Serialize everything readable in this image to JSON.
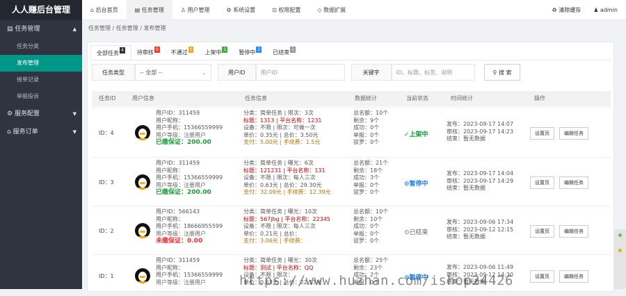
{
  "brand": "人人赚后台管理",
  "sidebar": {
    "groups": [
      {
        "label": "任务管理",
        "items": [
          "任务分类",
          "发布管理",
          "接单记录",
          "举报投诉"
        ]
      },
      {
        "label": "服务配置"
      },
      {
        "label": "服务订单"
      }
    ]
  },
  "topnav": [
    "后台首页",
    "任务管理",
    "用户管理",
    "系统设置",
    "权限配置",
    "数据扩展"
  ],
  "topright": {
    "clear": "清除缓存",
    "user": "admin"
  },
  "breadcrumb": "任务管理  /  任务管理  /  发布管理",
  "tabs": [
    {
      "label": "全部任务",
      "count": "4",
      "color": "#333"
    },
    {
      "label": "待审核",
      "count": "0",
      "color": "#ff3b30"
    },
    {
      "label": "不通过",
      "count": "0",
      "color": "#f5a623"
    },
    {
      "label": "上架中",
      "count": "1",
      "color": "#3fb33f"
    },
    {
      "label": "暂停中",
      "count": "2",
      "color": "#1e90ff"
    },
    {
      "label": "已结束",
      "count": "1",
      "color": "#999"
    }
  ],
  "filters": {
    "type_label": "任务类型",
    "type_value": "-- 全部 --",
    "uid_label": "用户ID",
    "uid_placeholder": "用户ID",
    "kw_label": "关键字",
    "kw_placeholder": "ID、标题、标签、说明",
    "search": "搜 索"
  },
  "columns": [
    "任务ID",
    "用户信息",
    "任务信息",
    "数据统计",
    "当前状态",
    "时间统计",
    "操作"
  ],
  "rows": [
    {
      "id": "ID：4",
      "user": [
        "用户ID：311459",
        "用户昵称：",
        "用户手机：15366559999",
        "用户等级：注册用户",
        "已缴保证：200.00"
      ],
      "task": [
        "分类：简单任务 | 限次：3次",
        "标题：1313 | 平台名称：1231",
        "设备：不限 | 限次：可做一次",
        "单价：0.35元 | 总价：3.50元",
        "支付：5.00元 | 手续费：1.5元"
      ],
      "stats": [
        "总名额：10个",
        "剩余：9个",
        "成功：0个",
        "举报：0个",
        "驳罗：0个"
      ],
      "status": "✓上架中",
      "time": [
        "发布：2023-09-17 14:07",
        "审核：2023-09-17 14:23",
        "结束：暂无数据"
      ],
      "actions": [
        "设置页",
        "编辑任务"
      ]
    },
    {
      "id": "ID：3",
      "user": [
        "用户ID：311459",
        "用户昵称：",
        "用户手机：15366559999",
        "用户等级：注册用户",
        "已缴保证：200.00"
      ],
      "task": [
        "分类：简单任务 | 曝光：6次",
        "标题：121231 | 平台名称：131",
        "设备：不限 | 限次：每人三次",
        "单价：0.63元 | 总价：29.30元",
        "支付：32.09元 | 手续费：12.39元"
      ],
      "stats": [
        "总名额：21个",
        "剩余：18个",
        "成功：3个",
        "举报：0个",
        "驳罗：0个"
      ],
      "status": "⊙暂停中",
      "time": [
        "发布：2023-09-17 14:04",
        "审核：2023-09-17 14:29",
        "结束：暂无数据"
      ],
      "actions": [
        "设置页",
        "编辑任务"
      ]
    },
    {
      "id": "ID：2",
      "user": [
        "用户ID：566143",
        "用户昵称：",
        "用户手机：18666955599",
        "用户等级：注册用户",
        "未缴保证：0.00"
      ],
      "task": [
        "分类：简单任务 | 曝光：10次",
        "标题：567jhg | 平台名称：22345",
        "设备：不限 | 限次：每人三次",
        "单价：0.21元 | 总价：",
        "支付：3.06元 | 手续费："
      ],
      "stats": [
        "总名额：10个",
        "剩余：10个",
        "成功：0个",
        "举报：0个",
        "驳罗：0个"
      ],
      "status": "⊙已结束",
      "time": [
        "发布：2023-09-06 17:34",
        "审核：2023-09-12 12:15",
        "结束：暂无数据"
      ],
      "actions": [
        "设置页",
        "编辑任务"
      ]
    },
    {
      "id": "ID：1",
      "user": [
        "用户ID：311459",
        "用户昵称：",
        "用户手机：15366559999",
        "用户等级：注册用户"
      ],
      "task": [
        "分类：简单任务 | 曝光：30次",
        "标题：测试 | 平台名称：QQ",
        "设备：不限 | 限次：",
        "单价：0.63元 | 总价：22.17元"
      ],
      "stats": [
        "总名额：25个",
        "剩余：23个",
        "成功：2个",
        "举报：0个"
      ],
      "status": "⊙暂停中",
      "time": [
        "发布：2023-09-06 11:49",
        "审核：2023-09-12 14:30",
        "结束：暂无数据"
      ],
      "actions": [
        "设置页",
        "编辑任务"
      ]
    }
  ],
  "watermark": "https://www.huzhan.com/ishop24426"
}
